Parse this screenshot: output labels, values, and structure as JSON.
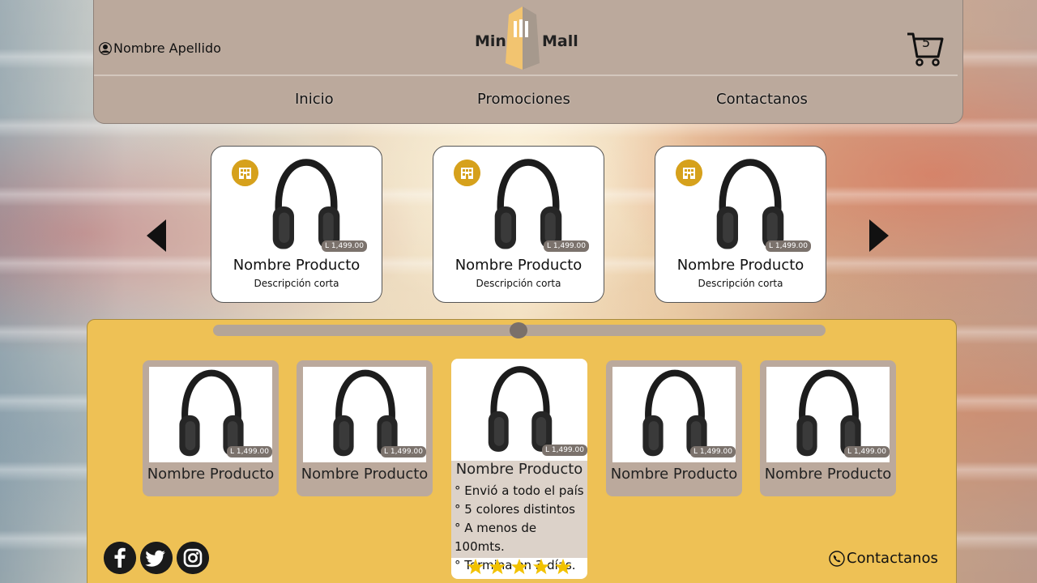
{
  "header": {
    "user_name": "Nombre Apellido",
    "logo_left": "Mini",
    "logo_right": "Mall",
    "cart_count": "5",
    "nav": [
      "Inicio",
      "Promociones",
      "Contactanos"
    ]
  },
  "carousel": {
    "cards": [
      {
        "name": "Nombre Producto",
        "desc": "Descripción corta",
        "price": "L 1,499.00"
      },
      {
        "name": "Nombre Producto",
        "desc": "Descripción corta",
        "price": "L 1,499.00"
      },
      {
        "name": "Nombre Producto",
        "desc": "Descripción corta",
        "price": "L 1,499.00"
      }
    ]
  },
  "products": {
    "tiles": [
      {
        "name": "Nombre Producto",
        "price": "L 1,499.00"
      },
      {
        "name": "Nombre Producto",
        "price": "L 1,499.00"
      },
      {
        "name": "Nombre Producto",
        "price": "L 1,499.00"
      },
      {
        "name": "Nombre Producto",
        "price": "L 1,499.00"
      }
    ],
    "featured": {
      "name": "Nombre Producto",
      "price": "L 1,499.00",
      "features": [
        "° Envió a todo el país",
        "° 5 colores distintos",
        "° A menos de 100mts.",
        "° Termina en 3 días."
      ],
      "rating": 5
    }
  },
  "footer": {
    "social": [
      "facebook-icon",
      "twitter-icon",
      "instagram-icon"
    ],
    "contact_label": "Contactanos"
  },
  "colors": {
    "header_bg": "#bba99c",
    "panel_bg": "#eec155",
    "badge": "#d6a11c",
    "star": "#f2c200"
  }
}
